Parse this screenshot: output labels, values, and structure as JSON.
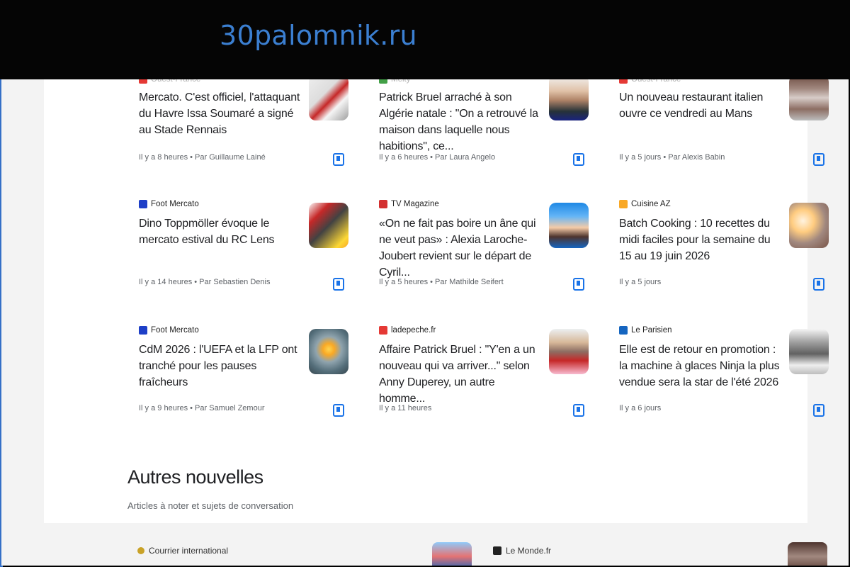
{
  "site": {
    "title": "30palomnik.ru"
  },
  "cards": [
    {
      "source": "Ouest-France",
      "headline": "Mercato. C'est officiel, l'attaquant du Havre Issa Soumaré a signé au Stade Rennais",
      "meta": "Il y a 8 heures • Par Guillaume Lainé",
      "logo_color": "#e53935"
    },
    {
      "source": "Melty",
      "headline": "Patrick Bruel arraché à son Algérie natale : \"On a retrouvé la maison dans laquelle nous habitions\", ce...",
      "meta": "Il y a 6 heures • Par Laura Angelo",
      "logo_color": "#43a047"
    },
    {
      "source": "Ouest-France",
      "headline": "Un nouveau restaurant italien ouvre ce vendredi au Mans",
      "meta": "Il y a 5 jours • Par Alexis Babin",
      "logo_color": "#e53935"
    },
    {
      "source": "Foot Mercato",
      "headline": "Dino Toppmöller évoque le mercato estival du RC Lens",
      "meta": "Il y a 14 heures • Par Sebastien Denis",
      "logo_color": "#1e3fc7"
    },
    {
      "source": "TV Magazine",
      "headline": "«On ne fait pas boire un âne qui ne veut pas» : Alexia Laroche-Joubert revient sur le départ de Cyril...",
      "meta": "Il y a 5 heures • Par Mathilde Seifert",
      "logo_color": "#d32f2f"
    },
    {
      "source": "Cuisine AZ",
      "headline": "Batch Cooking : 10 recettes du midi faciles pour la semaine du 15 au 19 juin 2026",
      "meta": "Il y a 5 jours",
      "logo_color": "#f9a825"
    },
    {
      "source": "Foot Mercato",
      "headline": "CdM 2026 : l'UEFA et la LFP ont tranché pour les pauses fraîcheurs",
      "meta": "Il y a 9 heures • Par Samuel Zemour",
      "logo_color": "#1e3fc7"
    },
    {
      "source": "ladepeche.fr",
      "headline": "Affaire Patrick Bruel : \"Y'en a un nouveau qui va arriver...\" selon Anny Duperey, un autre homme...",
      "meta": "Il y a 11 heures",
      "logo_color": "#e53935"
    },
    {
      "source": "Le Parisien",
      "headline": "Elle est de retour en promotion : la machine à glaces Ninja la plus vendue sera la star de l'été 2026",
      "meta": "Il y a 6 jours",
      "logo_color": "#1565c0"
    }
  ],
  "section": {
    "title": "Autres nouvelles",
    "subtitle": "Articles à noter et sujets de conversation"
  },
  "bottom": [
    {
      "source": "Courrier international"
    },
    {
      "source": "Le Monde.fr"
    }
  ],
  "icons": {
    "save": "bookmark-save-icon"
  }
}
